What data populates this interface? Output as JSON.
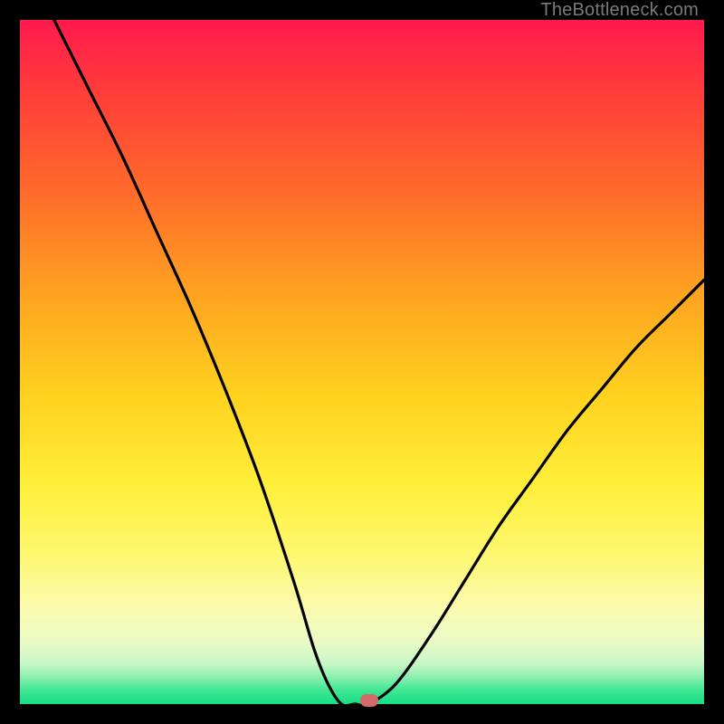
{
  "watermark": "TheBottleneck.com",
  "colors": {
    "frame": "#000000",
    "curve": "#000000",
    "marker": "#d46a6a"
  },
  "chart_data": {
    "type": "line",
    "title": "",
    "xlabel": "",
    "ylabel": "",
    "xlim": [
      0,
      100
    ],
    "ylim": [
      0,
      100
    ],
    "grid": false,
    "series": [
      {
        "name": "bottleneck-curve",
        "x": [
          5,
          10,
          15,
          20,
          25,
          30,
          35,
          40,
          43,
          45,
          47,
          49,
          51,
          55,
          60,
          65,
          70,
          75,
          80,
          85,
          90,
          95,
          100
        ],
        "values": [
          100,
          90,
          80,
          69,
          58,
          46,
          33,
          18,
          8,
          3,
          0,
          0,
          0,
          3,
          10,
          18,
          26,
          33,
          40,
          46,
          52,
          57,
          62
        ]
      }
    ],
    "annotations": [
      {
        "name": "optimal-marker",
        "x": 51,
        "y": 0
      }
    ]
  }
}
